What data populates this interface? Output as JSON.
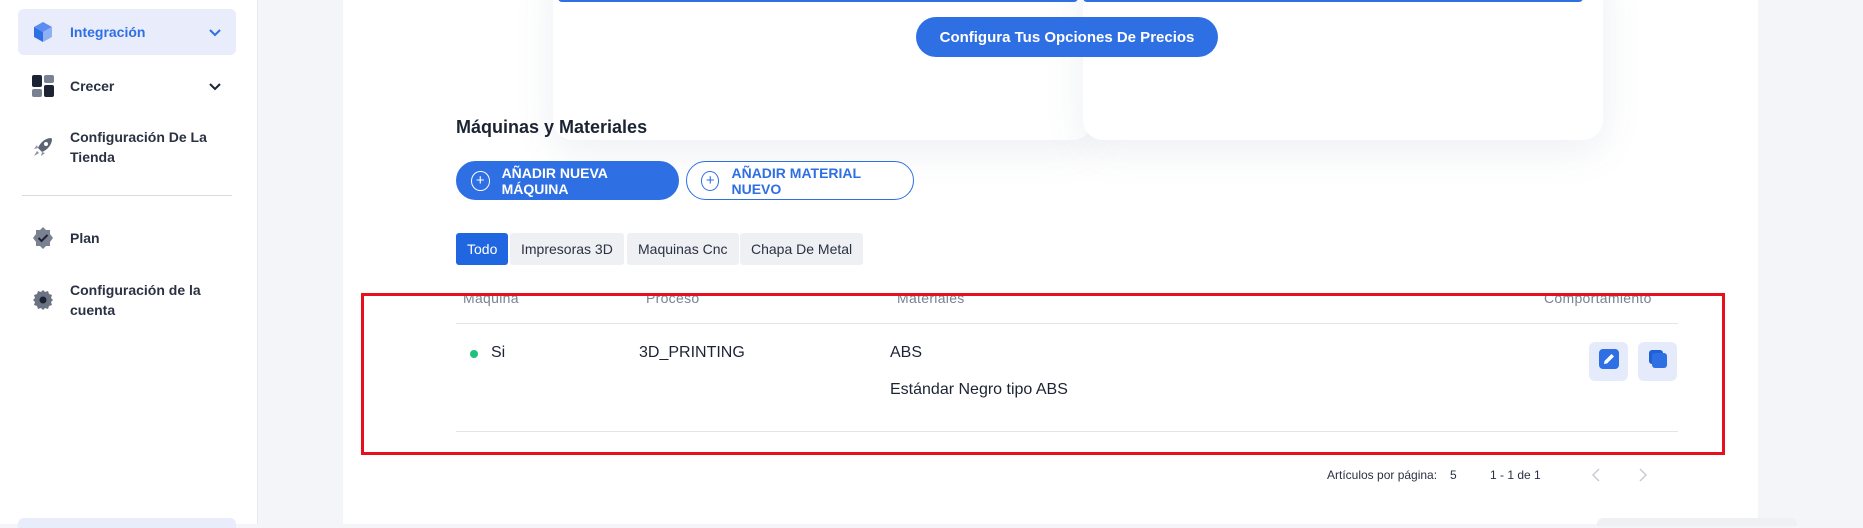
{
  "sidebar": {
    "items": [
      {
        "label": "Integración",
        "icon": "cube-icon",
        "active": true,
        "has_chevron": true
      },
      {
        "label": "Crecer",
        "icon": "grid-icon",
        "active": false,
        "has_chevron": true
      },
      {
        "label": "Configuración De La Tienda",
        "icon": "rocket-icon",
        "active": false,
        "has_chevron": false
      },
      {
        "label": "Plan",
        "icon": "badge-check-icon",
        "active": false,
        "has_chevron": false
      },
      {
        "label": "Configuración de la cuenta",
        "icon": "gear-icon",
        "active": false,
        "has_chevron": false
      }
    ]
  },
  "main": {
    "pricing_button": "Configura Tus Opciones De Precios",
    "section_title": "Máquinas y Materiales",
    "add_machine_button": "AÑADIR NUEVA MÁQUINA",
    "add_material_button": "AÑADIR MATERIAL NUEVO",
    "filter_tabs": [
      {
        "label": "Todo",
        "active": true
      },
      {
        "label": "Impresoras 3D",
        "active": false
      },
      {
        "label": "Maquinas Cnc",
        "active": false
      },
      {
        "label": "Chapa De Metal",
        "active": false
      }
    ],
    "table": {
      "columns": [
        "Maquina",
        "Proceso",
        "Materiales",
        "Comportamiento"
      ],
      "rows": [
        {
          "machine": "Si",
          "process": "3D_PRINTING",
          "materials": [
            "ABS",
            "Estándar Negro tipo ABS"
          ],
          "status_color": "#20c179"
        }
      ]
    },
    "pagination": {
      "per_page_label": "Artículos por página:",
      "per_page_value": "5",
      "range": "1 - 1 de 1"
    }
  },
  "colors": {
    "accent": "#2f6fe4",
    "highlight": "#e8101d",
    "status_active": "#20c179"
  }
}
